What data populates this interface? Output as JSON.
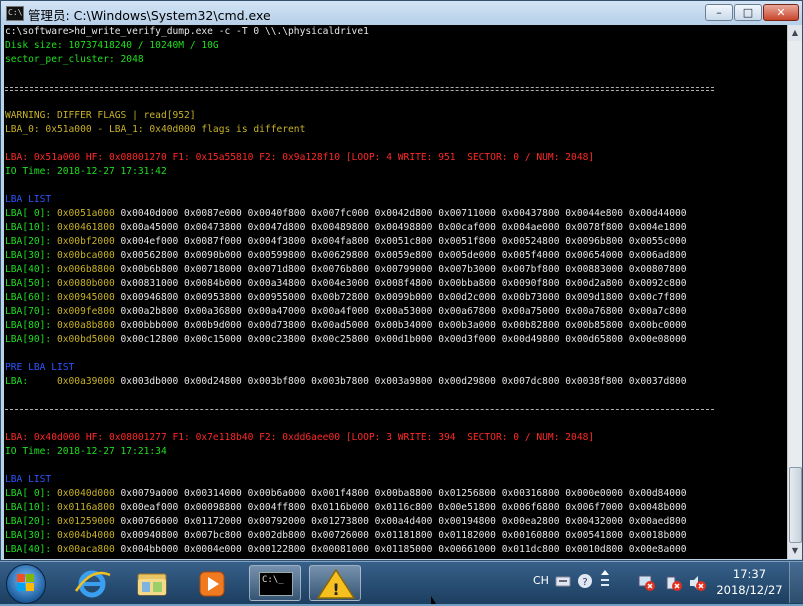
{
  "window": {
    "title": "管理员: C:\\Windows\\System32\\cmd.exe",
    "icon_glyph": "C:\\",
    "controls": {
      "minimize": "–",
      "maximize": "□",
      "close": "✕"
    }
  },
  "console": {
    "command": "c:\\software>hd_write_verify_dump.exe -c -T 0 \\\\.\\physicaldrive1",
    "disk_size": "Disk size: 10737418240 / 10240M / 10G",
    "sector_per_cluster": "sector_per_cluster: 2048",
    "warning": "WARNING: DIFFER FLAGS | read[952]",
    "lba_compare": "LBA_0: 0x51a000 - LBA_1: 0x40d000 flags is different",
    "block1": {
      "header": "LBA: 0x51a000 HF: 0x08001270 F1: 0x15a55810 F2: 0x9a128f10 [LOOP: 4 WRITE: 951  SECTOR: 0 / NUM: 2048]",
      "io_time": "IO Time: 2018-12-27 17:31:42",
      "lba_list_title": "LBA LIST",
      "rows": [
        {
          "label": "LBA[ 0]: ",
          "first": "0x0051a000",
          "rest": " 0x0040d000 0x0087e000 0x0040f800 0x007fc000 0x0042d800 0x00711000 0x00437800 0x0044e800 0x00d44000"
        },
        {
          "label": "LBA[10]: ",
          "first": "0x00461800",
          "rest": " 0x00a45000 0x00473800 0x0047d800 0x00489800 0x00498800 0x00caf000 0x004ae000 0x0078f800 0x004e1800"
        },
        {
          "label": "LBA[20]: ",
          "first": "0x00bf2000",
          "rest": " 0x004ef000 0x0087f000 0x004f3800 0x004fa800 0x0051c800 0x0051f800 0x00524800 0x0096b800 0x0055c000"
        },
        {
          "label": "LBA[30]: ",
          "first": "0x00bca000",
          "rest": " 0x00562800 0x0090b000 0x00599800 0x00629800 0x0059e800 0x005de000 0x005f4000 0x00654000 0x006ad800"
        },
        {
          "label": "LBA[40]: ",
          "first": "0x006b8800",
          "rest": " 0x00b6b800 0x00718000 0x0071d800 0x0076b800 0x00799000 0x007b3000 0x007bf800 0x00883000 0x00807800"
        },
        {
          "label": "LBA[50]: ",
          "first": "0x0080b000",
          "rest": " 0x00831000 0x0084b000 0x00a34800 0x004e3000 0x008f4800 0x00bba800 0x0090f800 0x00d2a800 0x0092c800"
        },
        {
          "label": "LBA[60]: ",
          "first": "0x00945000",
          "rest": " 0x00946800 0x00953800 0x00955000 0x00b72800 0x0099b000 0x00d2c000 0x00b73000 0x009d1800 0x00c7f800"
        },
        {
          "label": "LBA[70]: ",
          "first": "0x009fe800",
          "rest": " 0x00a2b800 0x00a36800 0x00a47000 0x00a4f000 0x00a53000 0x00a67800 0x00a75000 0x00a76800 0x00a7c800"
        },
        {
          "label": "LBA[80]: ",
          "first": "0x00a8b800",
          "rest": " 0x00bbb000 0x00b9d000 0x00d73800 0x00ad5000 0x00b34000 0x00b3a000 0x00b82800 0x00b85800 0x00bc0000"
        },
        {
          "label": "LBA[90]: ",
          "first": "0x00bd5000",
          "rest": " 0x00c12800 0x00c15000 0x00c23800 0x00c25800 0x00d1b000 0x00d3f000 0x00d49800 0x00d65800 0x00e08000"
        }
      ],
      "pre_title": "PRE LBA LIST",
      "pre_row": {
        "label": "LBA:     ",
        "first": "0x00a39000",
        "rest": " 0x003db000 0x00d24800 0x003bf800 0x003b7800 0x003a9800 0x00d29800 0x007dc800 0x0038f800 0x0037d800"
      }
    },
    "block2": {
      "header": "LBA: 0x40d000 HF: 0x08001277 F1: 0x7e118b40 F2: 0xdd6aee00 [LOOP: 3 WRITE: 394  SECTOR: 0 / NUM: 2048]",
      "io_time": "IO Time: 2018-12-27 17:21:34",
      "lba_list_title": "LBA LIST",
      "rows": [
        {
          "label": "LBA[ 0]: ",
          "first": "0x0040d000",
          "rest": " 0x0079a000 0x00314000 0x00b6a000 0x001f4800 0x00ba8800 0x01256800 0x00316800 0x000e0000 0x00d84000"
        },
        {
          "label": "LBA[10]: ",
          "first": "0x0116a800",
          "rest": " 0x00eaf000 0x00098800 0x004ff800 0x0116b000 0x0116c800 0x00e51800 0x006f6800 0x006f7000 0x0048b000"
        },
        {
          "label": "LBA[20]: ",
          "first": "0x01259000",
          "rest": " 0x00766000 0x01172000 0x00792000 0x01273800 0x00a4d400 0x00194800 0x00ea2800 0x00432000 0x00aed800"
        },
        {
          "label": "LBA[30]: ",
          "first": "0x004b4000",
          "rest": " 0x00940800 0x007bc800 0x002db800 0x00726000 0x01181800 0x01182000 0x00160800 0x00541800 0x0018b000"
        },
        {
          "label": "LBA[40]: ",
          "first": "0x00aca800",
          "rest": " 0x004bb000 0x0004e000 0x00122800 0x00081000 0x01185000 0x00661000 0x011dc800 0x0010d800 0x00e8a000"
        }
      ]
    }
  },
  "taskbar": {
    "apps": [
      {
        "name": "Internet Explorer",
        "icon": "ie-icon"
      },
      {
        "name": "Windows Explorer",
        "icon": "folder-icon"
      },
      {
        "name": "Windows Media Player",
        "icon": "media-player-icon"
      },
      {
        "name": "cmd.exe",
        "icon": "cmd-icon",
        "glyph": "C:\\_",
        "active": true
      },
      {
        "name": "Warning",
        "icon": "warning-icon",
        "glyph": "!"
      }
    ],
    "tray": {
      "lang": "CH"
    },
    "clock": {
      "time": "17:37",
      "date": "2018/12/27"
    }
  },
  "colors": {
    "console_bg": "#000000",
    "green": "#1ee01e",
    "yellow": "#c8b228",
    "red": "#ff2828",
    "blue": "#2b55ff",
    "taskbar": "#27507a"
  }
}
